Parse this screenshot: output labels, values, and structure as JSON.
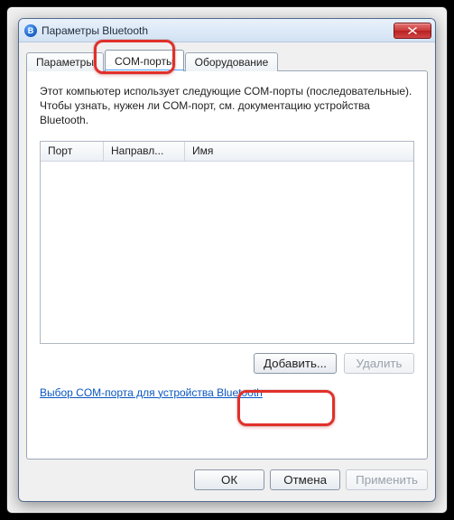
{
  "window": {
    "title": "Параметры Bluetooth"
  },
  "tabs": {
    "params": "Параметры",
    "com_ports": "COM-порты",
    "hardware": "Оборудование"
  },
  "panel": {
    "description": "Этот компьютер использует следующие COM-порты (последовательные). Чтобы узнать, нужен ли COM-порт, см. документацию устройства Bluetooth."
  },
  "columns": {
    "port": "Порт",
    "direction": "Направл...",
    "name": "Имя"
  },
  "buttons": {
    "add": "Добавить...",
    "delete": "Удалить",
    "ok": "ОК",
    "cancel": "Отмена",
    "apply": "Применить"
  },
  "link": {
    "text": "Выбор COM-порта для устройства Bluetooth"
  }
}
